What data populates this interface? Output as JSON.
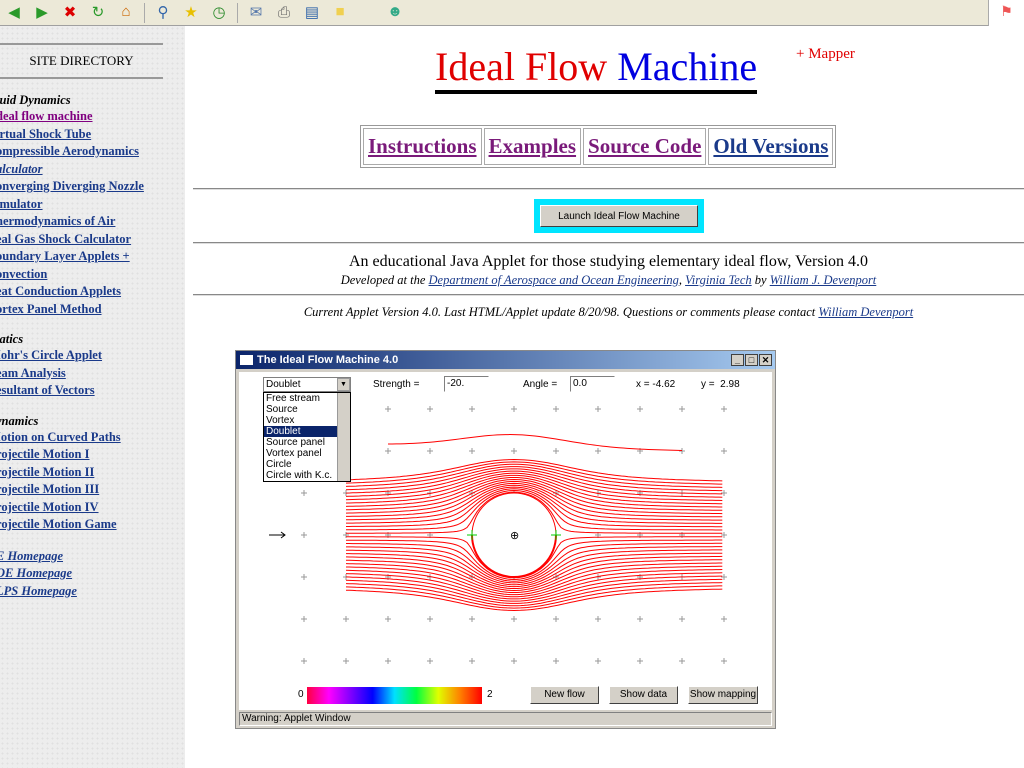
{
  "browser_toolbar": {
    "icons": [
      "back-icon",
      "forward-icon",
      "stop-icon",
      "refresh-icon",
      "home-icon",
      "search-icon",
      "favorites-icon",
      "history-icon",
      "mail-icon",
      "print-icon",
      "edit-icon",
      "notes-icon",
      "messenger-icon"
    ]
  },
  "sidebar": {
    "heading": "SITE DIRECTORY",
    "sections": [
      {
        "title": "luid Dynamics",
        "items": [
          {
            "label": "deal flow machine",
            "visited": true
          },
          {
            "label": "irtual Shock Tube"
          },
          {
            "label": "ompressible Aerodynamics"
          },
          {
            "label": "alculator",
            "italic": true
          },
          {
            "label": "onverging Diverging Nozzle"
          },
          {
            "label": "imulator"
          },
          {
            "label": "hermodynamics of Air"
          },
          {
            "label": "eal Gas Shock Calculator"
          },
          {
            "label": "oundary Layer Applets +"
          },
          {
            "label": "onvection"
          },
          {
            "label": "eat Conduction Applets"
          },
          {
            "label": "ortex Panel Method"
          }
        ]
      },
      {
        "title": "tatics",
        "items": [
          {
            "label": "Iohr's Circle Applet"
          },
          {
            "label": "eam Analysis"
          },
          {
            "label": "esultant of Vectors"
          }
        ]
      },
      {
        "title": "ynamics",
        "items": [
          {
            "label": "Iotion on Curved Paths"
          },
          {
            "label": "rojectile Motion I"
          },
          {
            "label": "rojectile Motion II"
          },
          {
            "label": "rojectile Motion III"
          },
          {
            "label": "rojectile Motion IV"
          },
          {
            "label": "rojectile Motion Game"
          }
        ]
      },
      {
        "title": "",
        "items": [
          {
            "label": "E Homepage",
            "italic": true
          },
          {
            "label": "OE Homepage",
            "italic": true
          },
          {
            "label": "LPS Homepage",
            "italic": true
          }
        ]
      }
    ]
  },
  "header": {
    "title_red": "Ideal Flow",
    "title_blue": "Machine",
    "superscript": "+ Mapper"
  },
  "nav": [
    "Instructions",
    "Examples",
    "Source Code",
    "Old Versions"
  ],
  "launch_button": "Launch Ideal Flow Machine",
  "intro": {
    "line1": "An educational Java Applet for those studying elementary ideal flow, Version 4.0",
    "dev_prefix": "Developed at the ",
    "dept": "Department of Aerospace and Ocean Engineering",
    "comma": ", ",
    "vt": "Virginia Tech",
    "by": " by ",
    "author": "William J. Devenport",
    "current": "Current Applet Version 4.0. Last HTML/Applet update 8/20/98. Questions or comments please contact ",
    "contact": "William Devenport"
  },
  "applet": {
    "title": "The Ideal Flow Machine 4.0",
    "selected": "Doublet",
    "options": [
      "Free stream",
      "Source",
      "Vortex",
      "Doublet",
      "Source panel",
      "Vortex panel",
      "Circle",
      "Circle with K.c."
    ],
    "strength_label": "Strength =",
    "strength": "-20.",
    "angle_label": "Angle =",
    "angle": "0.0",
    "x_readout": "x = -4.62",
    "y_readout": "y =  2.98",
    "scale_min": "0",
    "scale_max": "2",
    "buttons": [
      "New flow",
      "Show data",
      "Show mapping"
    ],
    "status": "Warning: Applet Window",
    "streamline_color": "#ff0000"
  }
}
